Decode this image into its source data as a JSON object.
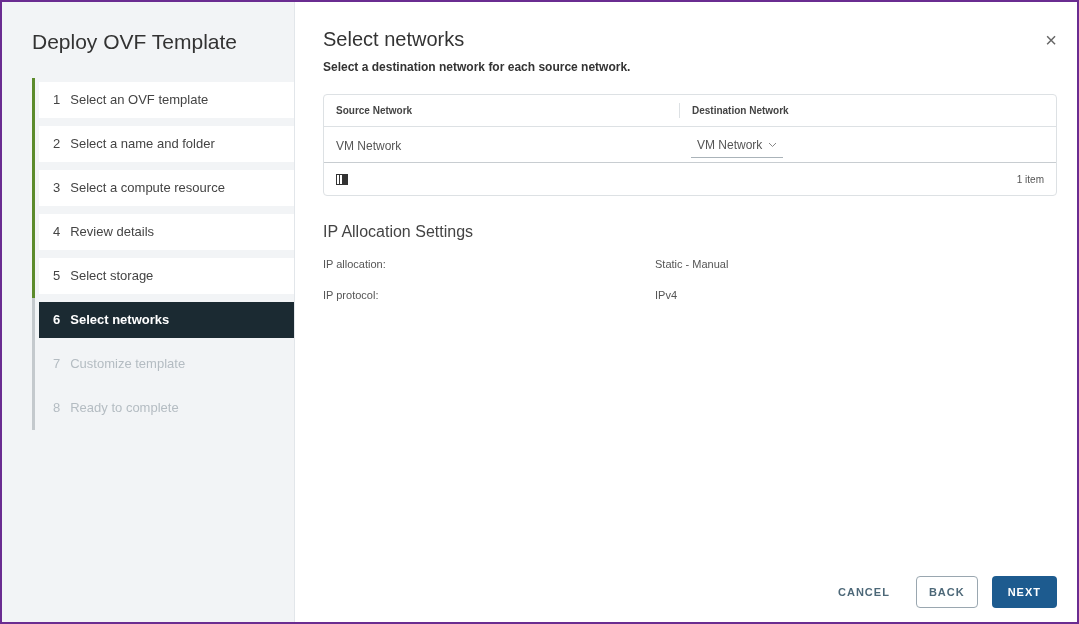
{
  "wizard": {
    "title": "Deploy OVF Template"
  },
  "steps": [
    {
      "number": "1",
      "label": "Select an OVF template",
      "completed": true,
      "selected": false,
      "disabled": false
    },
    {
      "number": "2",
      "label": "Select a name and folder",
      "completed": true,
      "selected": false,
      "disabled": false
    },
    {
      "number": "3",
      "label": "Select a compute resource",
      "completed": true,
      "selected": false,
      "disabled": false
    },
    {
      "number": "4",
      "label": "Review details",
      "completed": true,
      "selected": false,
      "disabled": false
    },
    {
      "number": "5",
      "label": "Select storage",
      "completed": true,
      "selected": false,
      "disabled": false
    },
    {
      "number": "6",
      "label": "Select networks",
      "completed": false,
      "selected": true,
      "disabled": false
    },
    {
      "number": "7",
      "label": "Customize template",
      "completed": false,
      "selected": false,
      "disabled": true
    },
    {
      "number": "8",
      "label": "Ready to complete",
      "completed": false,
      "selected": false,
      "disabled": true
    }
  ],
  "page": {
    "title": "Select networks",
    "close": "×",
    "subtitle": "Select a destination network for each source network."
  },
  "table": {
    "columns": [
      "Source Network",
      "Destination Network"
    ],
    "rows": [
      {
        "source": "VM Network",
        "destination": "VM Network"
      }
    ],
    "footer": "1 item"
  },
  "ip_settings": {
    "title": "IP Allocation Settings",
    "fields": [
      {
        "label": "IP allocation:",
        "value": "Static - Manual"
      },
      {
        "label": "IP protocol:",
        "value": "IPv4"
      }
    ]
  },
  "buttons": [
    {
      "label": "CANCEL",
      "kind": "flat"
    },
    {
      "label": "BACK",
      "kind": "outline"
    },
    {
      "label": "NEXT",
      "kind": "primary"
    }
  ]
}
